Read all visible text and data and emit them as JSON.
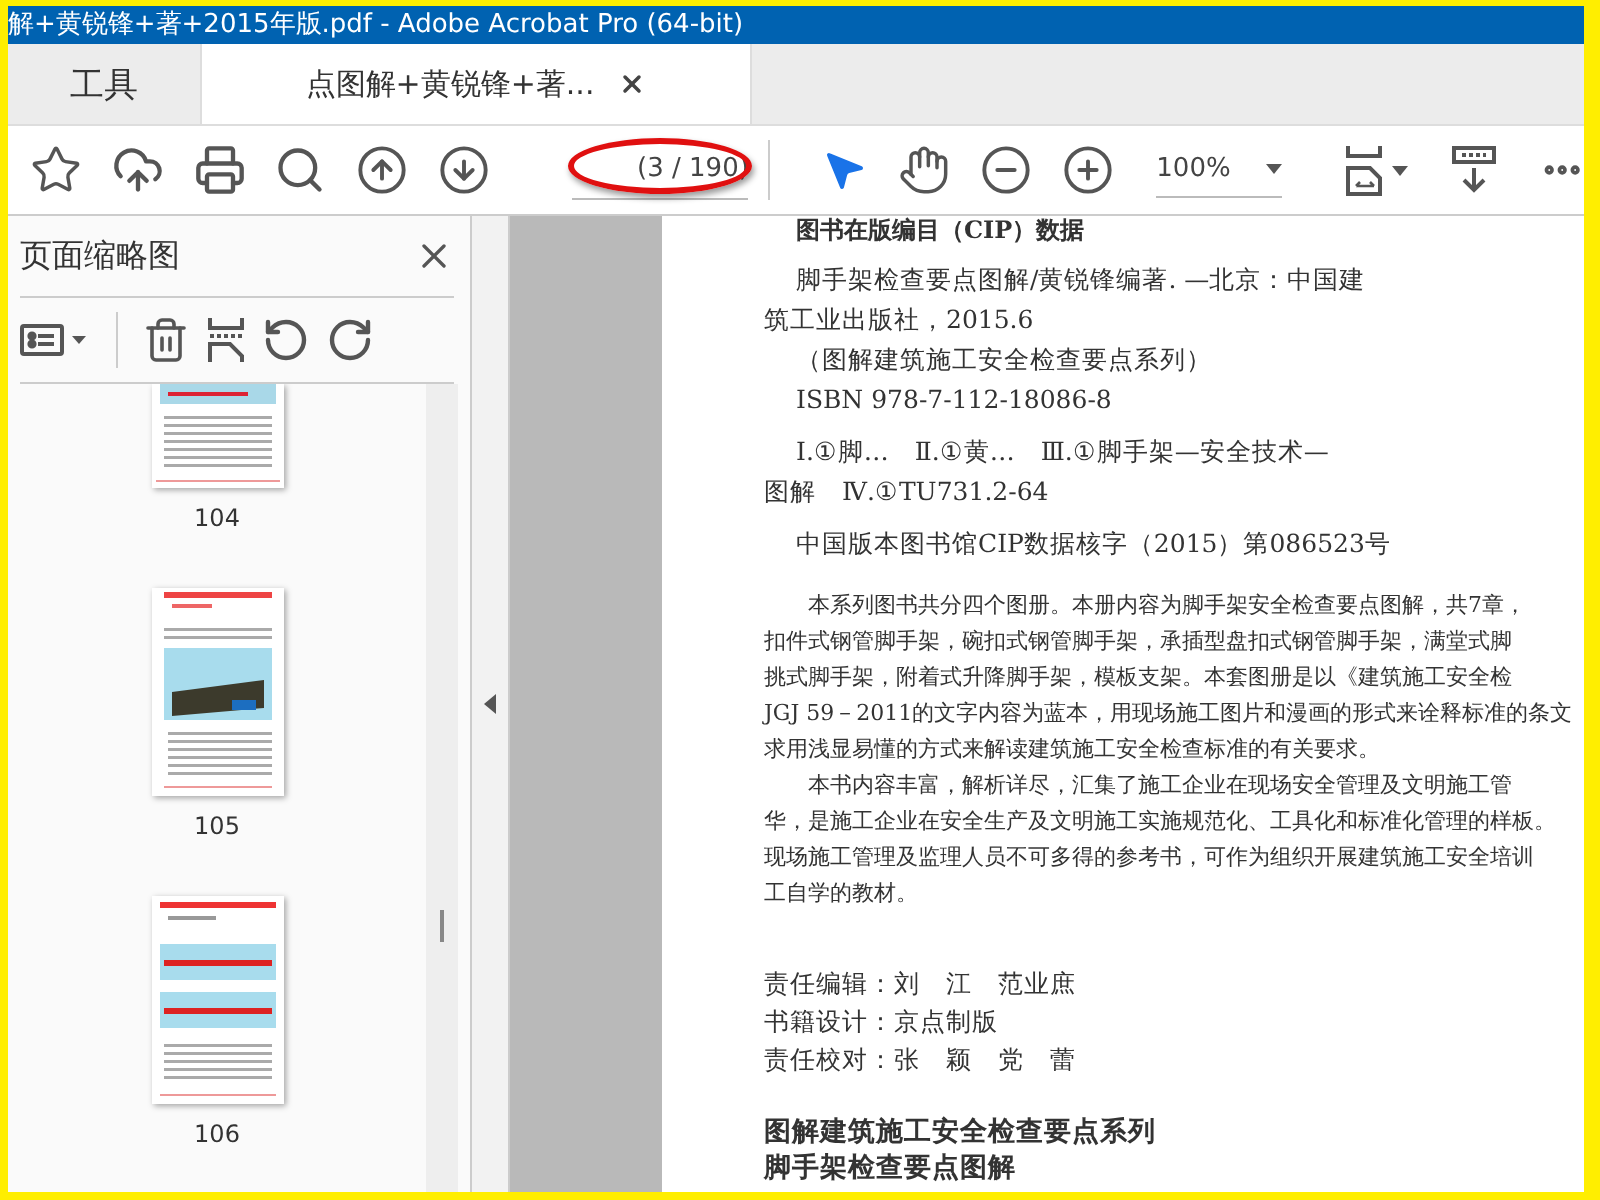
{
  "window": {
    "title": "解+黄锐锋+著+2015年版.pdf - Adobe Acrobat Pro (64-bit)"
  },
  "tabs": [
    {
      "label": "工具",
      "selected": false,
      "closable": false
    },
    {
      "label": "点图解+黄锐锋+著...",
      "selected": true,
      "closable": true
    }
  ],
  "toolbar": {
    "page_indicator": "(3 / 190)",
    "page_indicator_circled": true,
    "zoom": "100%"
  },
  "sidebar": {
    "title": "页面缩略图",
    "thumbnails": [
      {
        "label": "104",
        "kind": "cut"
      },
      {
        "label": "105",
        "kind": "photo"
      },
      {
        "label": "106",
        "kind": "diagram"
      }
    ]
  },
  "page": {
    "blocks": [
      {
        "kind": "cip-title",
        "lines": [
          {
            "text": "图书在版编目（CIP）数据",
            "indent": true
          }
        ]
      },
      {
        "kind": "cip",
        "lines": [
          {
            "text": "脚手架检查要点图解/黄锐锋编著. —北京：中国建",
            "indent": true
          },
          {
            "text": "筑工业出版社，2015.6",
            "indent": false
          },
          {
            "text": "（图解建筑施工安全检查要点系列）",
            "indent": true
          },
          {
            "text": "ISBN 978-7-112-18086-8",
            "indent": true
          }
        ]
      },
      {
        "kind": "cip",
        "lines": [
          {
            "text": "Ⅰ.①脚…　Ⅱ.①黄…　Ⅲ.①脚手架—安全技术—",
            "indent": true
          },
          {
            "text": "图解　Ⅳ.①TU731.2-64",
            "indent": false
          }
        ]
      },
      {
        "kind": "cip",
        "lines": [
          {
            "text": "中国版本图书馆CIP数据核字（2015）第086523号",
            "indent": true
          }
        ]
      },
      {
        "kind": "para",
        "lines": [
          {
            "text": "本系列图书共分四个图册。本册内容为脚手架安全检查要点图解，共7章，",
            "indent": true
          },
          {
            "text": "扣件式钢管脚手架，碗扣式钢管脚手架，承插型盘扣式钢管脚手架，满堂式脚",
            "indent": false
          },
          {
            "text": "挑式脚手架，附着式升降脚手架，模板支架。本套图册是以《建筑施工安全检",
            "indent": false
          },
          {
            "text": "JGJ 59－2011的文字内容为蓝本，用现场施工图片和漫画的形式来诠释标准的条文",
            "indent": false
          },
          {
            "text": "求用浅显易懂的方式来解读建筑施工安全检查标准的有关要求。",
            "indent": false
          },
          {
            "text": "本书内容丰富，解析详尽，汇集了施工企业在现场安全管理及文明施工管",
            "indent": true
          },
          {
            "text": "华，是施工企业在安全生产及文明施工实施规范化、工具化和标准化管理的样板。",
            "indent": false
          },
          {
            "text": "现场施工管理及监理人员不可多得的参考书，可作为组织开展建筑施工安全培训",
            "indent": false
          },
          {
            "text": "工自学的教材。",
            "indent": false
          }
        ]
      },
      {
        "kind": "credit",
        "lines": [
          {
            "text": "责任编辑：刘　江　范业庶",
            "indent": false
          },
          {
            "text": "书籍设计：京点制版",
            "indent": false
          },
          {
            "text": "责任校对：张　颖　党　蕾",
            "indent": false
          }
        ]
      },
      {
        "kind": "series",
        "lines": [
          {
            "text": "图解建筑施工安全检查要点系列",
            "indent": false
          },
          {
            "text": "脚手架检查要点图解",
            "indent": false
          }
        ]
      }
    ]
  }
}
